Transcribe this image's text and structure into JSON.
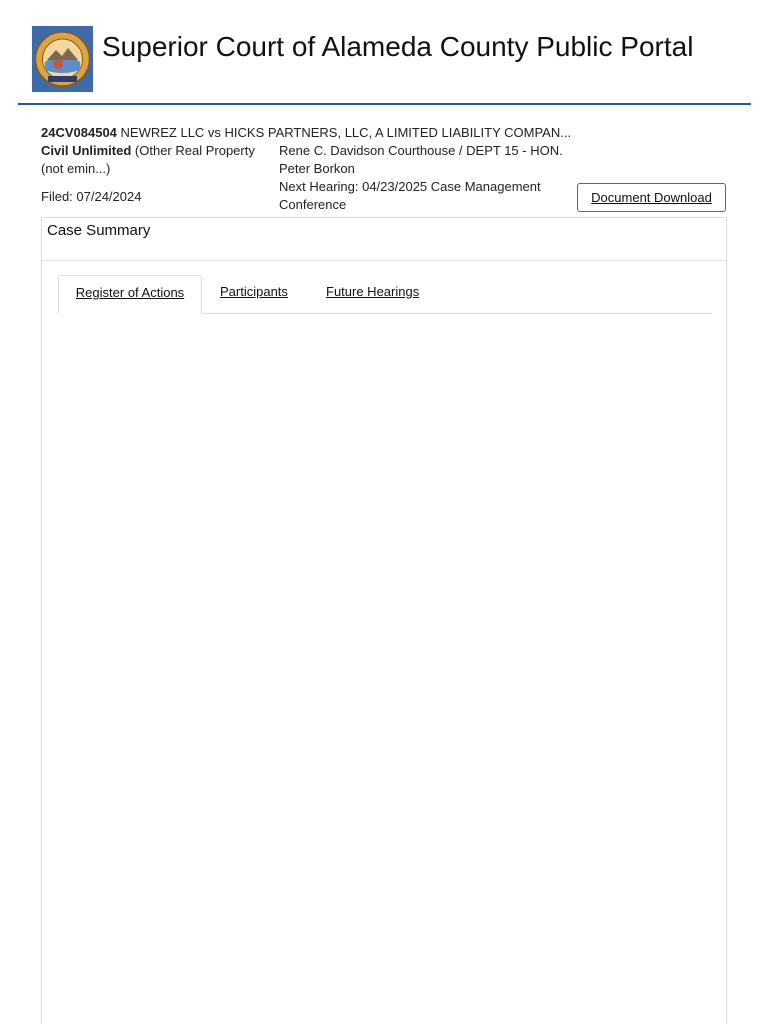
{
  "header": {
    "title": "Superior Court of Alameda County Public Portal",
    "seal_icon": "california-seal-icon",
    "seal_text": "THE GREAT SEAL OF THE STATE OF CALIFORNIA",
    "seal_banner": "EUREKA",
    "accent_color": "#2b5797"
  },
  "case": {
    "number": "24CV084504",
    "title": "NEWREZ LLC vs HICKS PARTNERS, LLC, A LIMITED LIABILITY COMPAN...",
    "type": "Civil Unlimited",
    "type_detail": "(Other Real Property (not emin...)",
    "filed": "Filed: 07/24/2024",
    "location": "Rene C. Davidson Courthouse / DEPT 15 - HON. Peter Borkon",
    "next_hearing": "Next Hearing: 04/23/2025 Case Management Conference",
    "document_download_label": "Document Download"
  },
  "summary": {
    "heading": "Case Summary",
    "tabs": [
      {
        "label": "Register of Actions",
        "active": true
      },
      {
        "label": "Participants",
        "active": false
      },
      {
        "label": "Future Hearings",
        "active": false
      }
    ]
  }
}
